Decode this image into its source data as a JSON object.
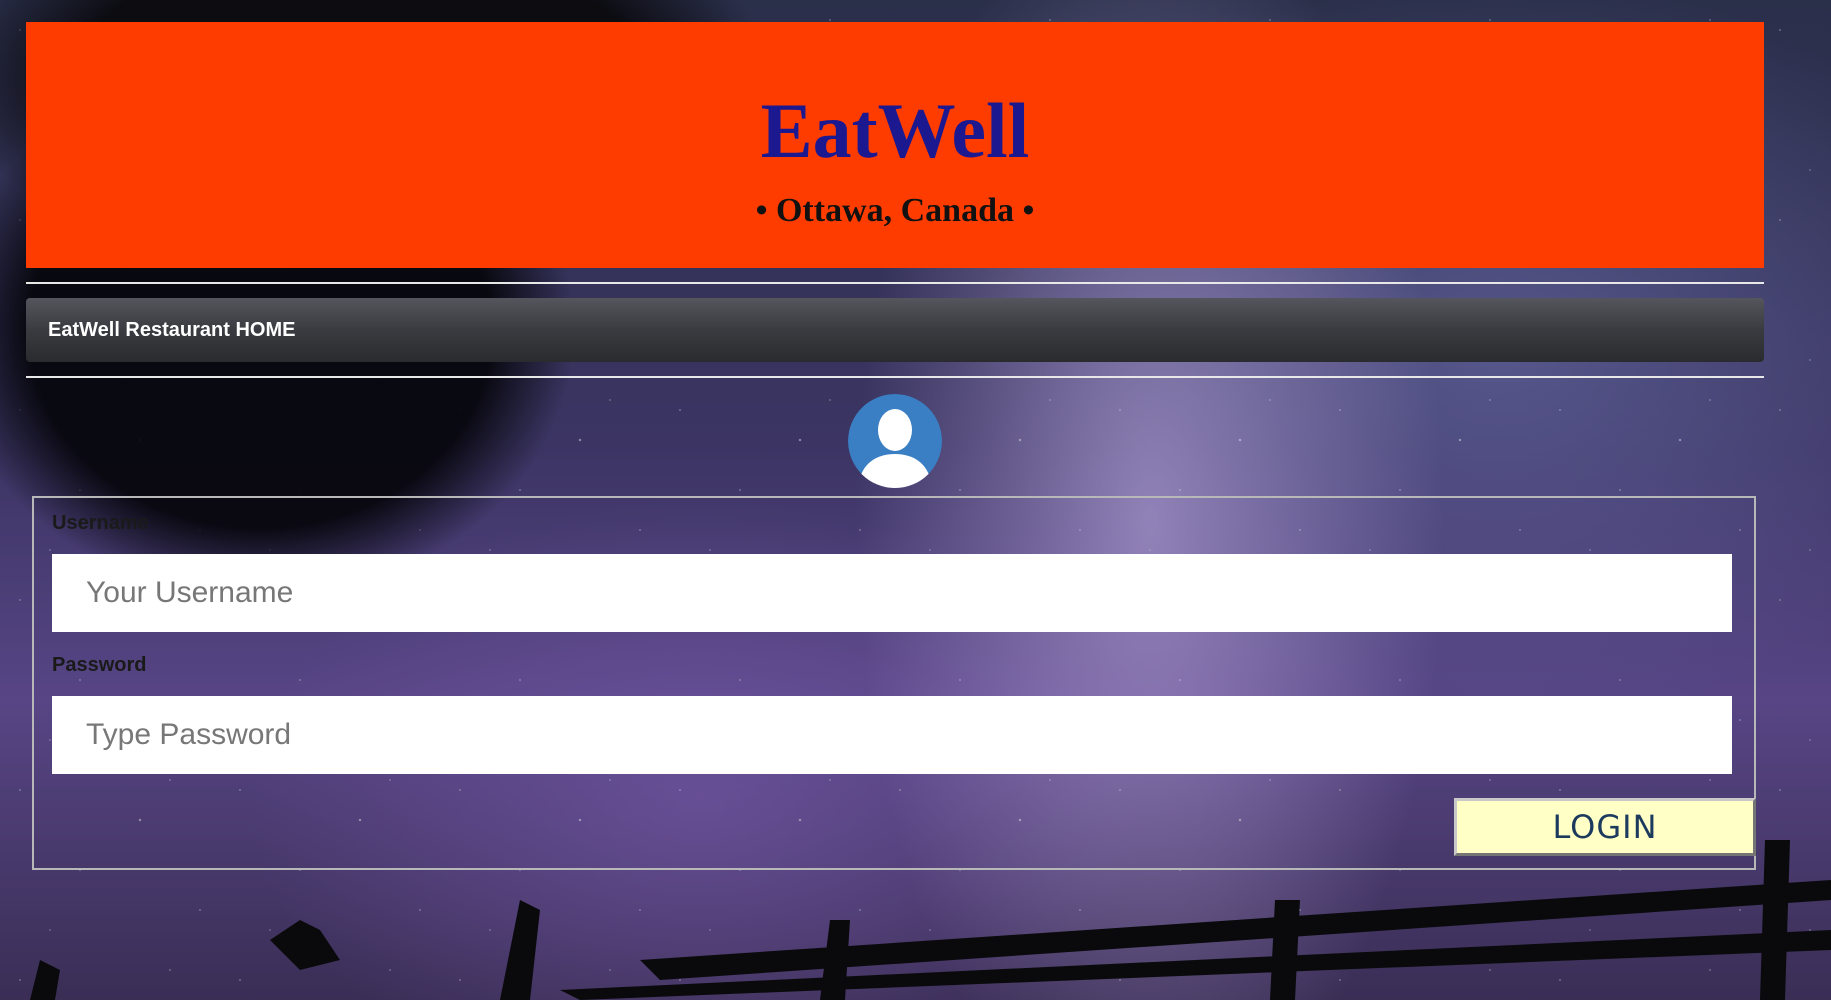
{
  "header": {
    "title": "EatWell",
    "subtitle": "• Ottawa, Canada •"
  },
  "nav": {
    "home_link": "EatWell Restaurant HOME"
  },
  "login_form": {
    "username_label": "Username",
    "username_placeholder": "Your Username",
    "password_label": "Password",
    "password_placeholder": "Type Password",
    "login_button": "LOGIN"
  },
  "icons": {
    "avatar": "user-avatar-icon"
  },
  "colors": {
    "header_bg": "#ff3c00",
    "title": "#1b1890",
    "login_button_bg": "#ffffc6",
    "avatar_bg": "#3a7fc4"
  }
}
